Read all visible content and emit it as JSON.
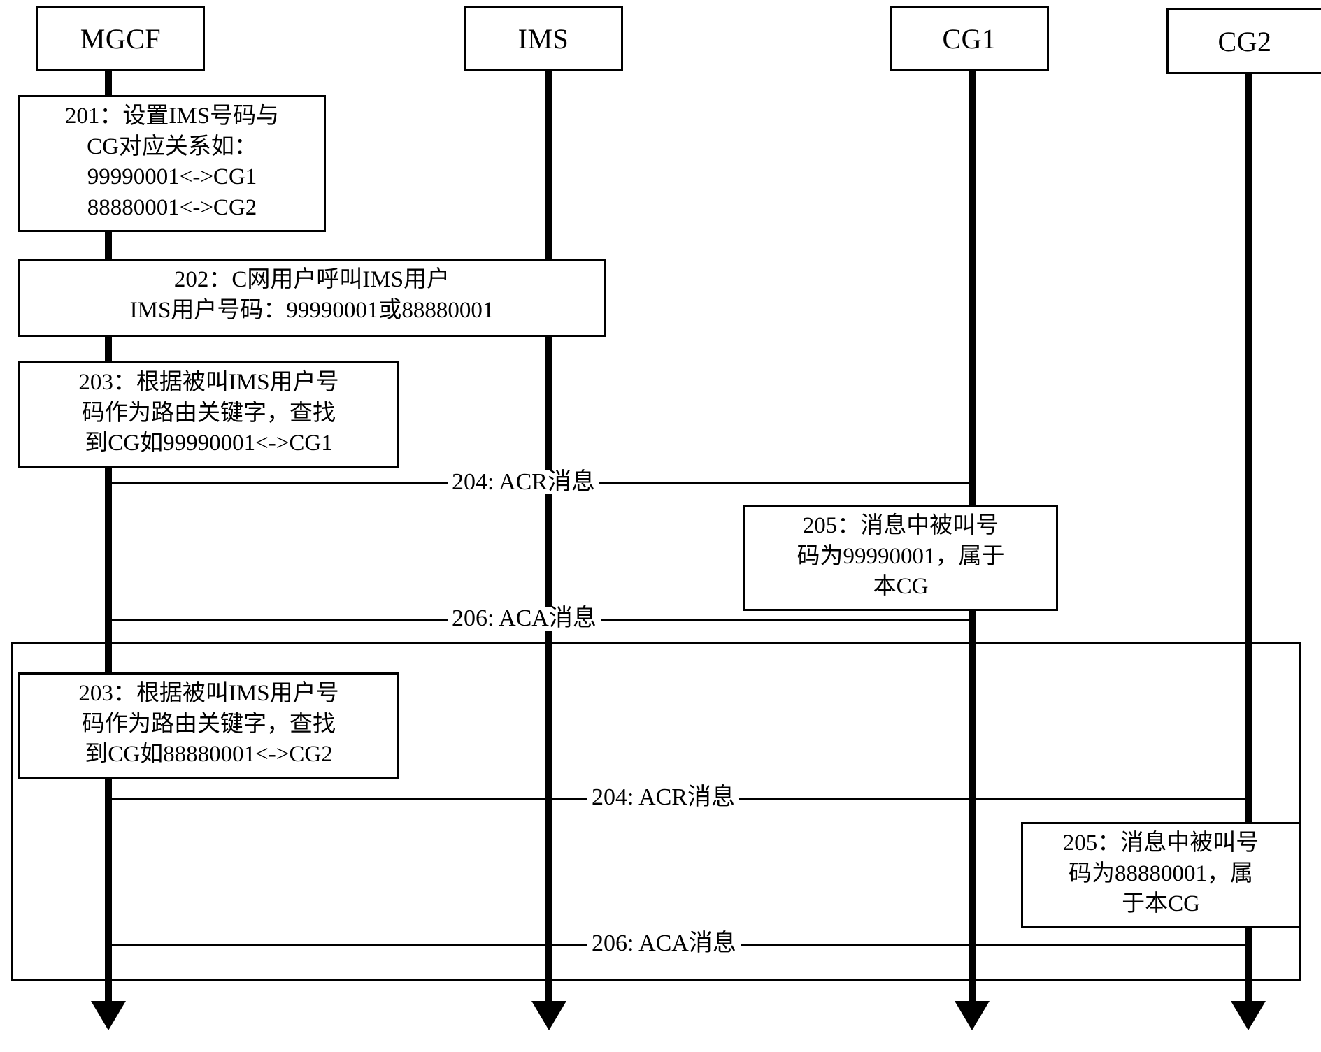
{
  "diagram": {
    "type": "uml-sequence-diagram",
    "title": "",
    "lifelines": [
      {
        "id": "mgcf",
        "label": "MGCF"
      },
      {
        "id": "ims",
        "label": "IMS"
      },
      {
        "id": "cg1",
        "label": "CG1"
      },
      {
        "id": "cg2",
        "label": "CG2"
      }
    ],
    "notes": [
      {
        "id": "note-201",
        "step": "201",
        "on": "mgcf",
        "lines": [
          "201：设置IMS号码与",
          "CG对应关系如：",
          "99990001<->CG1",
          "88880001<->CG2"
        ]
      },
      {
        "id": "note-202",
        "step": "202",
        "on": "mgcf-ims",
        "lines": [
          "202：C网用户呼叫IMS用户",
          "IMS用户号码：99990001或88880001"
        ]
      },
      {
        "id": "note-203-a",
        "step": "203",
        "on": "mgcf",
        "lines": [
          "203：根据被叫IMS用户号",
          "码作为路由关键字，查找",
          "到CG如99990001<->CG1"
        ]
      },
      {
        "id": "note-205-a",
        "step": "205",
        "on": "cg1",
        "lines": [
          "205：消息中被叫号",
          "码为99990001，属于",
          "本CG"
        ]
      },
      {
        "id": "note-203-b",
        "step": "203",
        "on": "mgcf",
        "lines": [
          "203：根据被叫IMS用户号",
          "码作为路由关键字，查找",
          "到CG如88880001<->CG2"
        ]
      },
      {
        "id": "note-205-b",
        "step": "205",
        "on": "cg2",
        "lines": [
          "205：消息中被叫号",
          "码为88880001，属",
          "于本CG"
        ]
      }
    ],
    "messages": [
      {
        "id": "msg-204-a",
        "step": "204",
        "label": "204: ACR消息",
        "from": "mgcf",
        "to": "cg1"
      },
      {
        "id": "msg-206-a",
        "step": "206",
        "label": "206: ACA消息",
        "from": "cg1",
        "to": "mgcf"
      },
      {
        "id": "msg-204-b",
        "step": "204",
        "label": "204: ACR消息",
        "from": "mgcf",
        "to": "cg2"
      },
      {
        "id": "msg-206-b",
        "step": "206",
        "label": "206: ACA消息",
        "from": "cg2",
        "to": "mgcf"
      }
    ],
    "colors": {
      "stroke": "#000000",
      "background": "#ffffff"
    }
  }
}
